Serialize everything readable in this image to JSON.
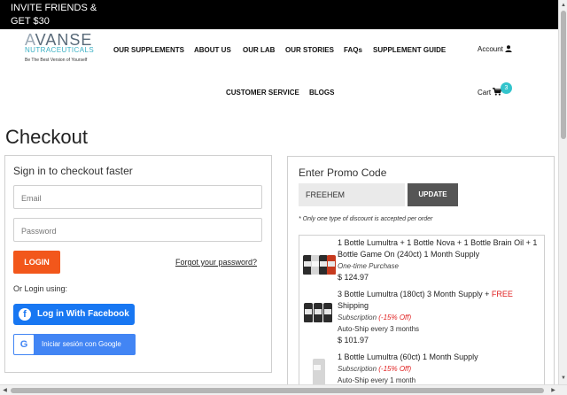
{
  "topbar": {
    "promo_line1": "INVITE FRIENDS &",
    "promo_line2": "GET $30"
  },
  "logo": {
    "brand_prefix": "A",
    "brand_rest": "VANSE",
    "subtitle": "NUTRACEUTICALS",
    "tagline": "Be The Best Version of Yourself"
  },
  "nav": {
    "items": [
      {
        "label": "OUR SUPPLEMENTS"
      },
      {
        "label": "ABOUT US"
      },
      {
        "label": "OUR LAB"
      },
      {
        "label": "OUR STORIES"
      },
      {
        "label": "FAQs"
      },
      {
        "label": "SUPPLEMENT GUIDE"
      },
      {
        "label": "CUSTOMER SERVICE"
      },
      {
        "label": "BLOGS"
      }
    ],
    "account_label": "Account",
    "cart_label": "Cart",
    "cart_count": "3"
  },
  "page": {
    "title": "Checkout"
  },
  "signin": {
    "title": "Sign in to checkout faster",
    "email_placeholder": "Email",
    "password_placeholder": "Password",
    "login_label": "LOGIN",
    "forgot_label": "Forgot your password?",
    "or_login": "Or Login using:",
    "facebook_label": "Log in With Facebook",
    "google_label": "Iniciar sesión con Google"
  },
  "promo": {
    "title": "Enter Promo Code",
    "code_value": "FREEHEM",
    "update_label": "UPDATE",
    "note": "* Only one type of discount is accepted per order"
  },
  "cart_items": [
    {
      "name": "1 Bottle Lumultra + 1 Bottle Nova + 1 Bottle Brain Oil + 1 Bottle Game On (240ct) 1 Month Supply",
      "purchase_type": "One-time Purchase",
      "price": "$ 124.97"
    },
    {
      "name": "3 Bottle Lumultra (180ct) 3 Month Supply + ",
      "free_text": "FREE",
      "name_tail": "Shipping",
      "purchase_type": "Subscription",
      "discount": "(-15% Off)",
      "autoship": "Auto-Ship every 3 months",
      "price": "$ 101.97"
    },
    {
      "name": "1 Bottle Lumultra (60ct) 1 Month Supply",
      "purchase_type": "Subscription",
      "discount": "(-15% Off)",
      "autoship": "Auto-Ship every 1 month"
    }
  ],
  "colors": {
    "accent_orange": "#f2571b",
    "facebook_blue": "#1877f2",
    "google_blue": "#4285f4",
    "cart_badge": "#33c4cc",
    "discount_red": "#e02020"
  },
  "icons": {
    "account": "user-icon",
    "cart": "cart-icon",
    "facebook": "facebook-icon",
    "google": "google-icon"
  }
}
